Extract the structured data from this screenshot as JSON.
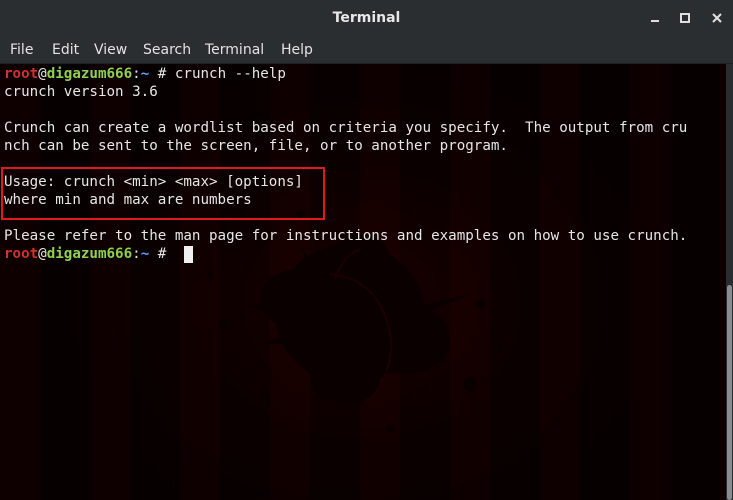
{
  "window": {
    "title": "Terminal"
  },
  "menubar": {
    "items": [
      "File",
      "Edit",
      "View",
      "Search",
      "Terminal",
      "Help"
    ]
  },
  "prompt": {
    "user": "root",
    "at": "@",
    "host": "digazum666",
    "sep": ":",
    "path": "~",
    "sign": "#"
  },
  "terminal": {
    "command": " crunch --help",
    "lines": [
      "crunch version 3.6",
      "",
      "Crunch can create a wordlist based on criteria you specify.  The output from cru",
      "nch can be sent to the screen, file, or to another program.",
      "",
      "Usage: crunch <min> <max> [options]",
      "where min and max are numbers",
      "",
      "Please refer to the man page for instructions and examples on how to use crunch."
    ]
  },
  "colors": {
    "user": "#d2322d",
    "host": "#8fd14f",
    "path": "#5ea0ff",
    "highlight": "#e01a1a",
    "titlebar": "#2b2e30"
  }
}
